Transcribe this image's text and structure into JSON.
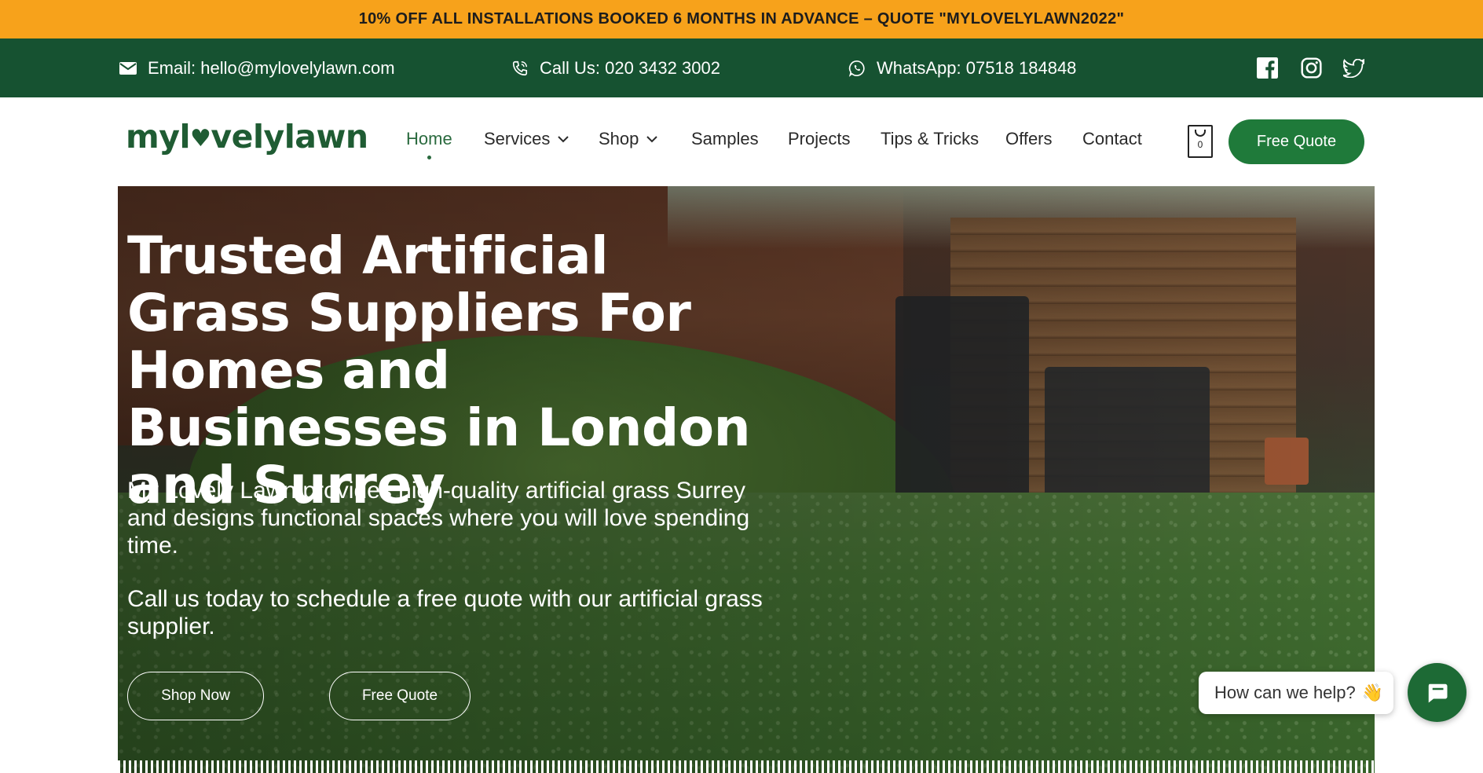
{
  "promo": {
    "text": "10% OFF ALL INSTALLATIONS BOOKED 6 MONTHS IN ADVANCE – QUOTE \"MYLOVELYLAWN2022\""
  },
  "contact": {
    "email": "Email: hello@mylovelylawn.com",
    "phone": "Call Us: 020 3432 3002",
    "whatsapp": "WhatsApp: 07518 184848"
  },
  "social": {
    "icons": [
      "facebook-icon",
      "instagram-icon",
      "twitter-icon"
    ]
  },
  "logo": {
    "part1": "myl",
    "part2": "velylawn"
  },
  "nav": {
    "home": "Home",
    "services": "Services",
    "shop": "Shop",
    "samples": "Samples",
    "projects": "Projects",
    "tips": "Tips & Tricks",
    "offers": "Offers",
    "contact": "Contact"
  },
  "cart": {
    "count": "0"
  },
  "header_button": "Free Quote",
  "hero": {
    "title": "Trusted Artificial Grass Suppliers For Homes and Businesses in London and Surrey",
    "p1": "My Lovely Lawn provides high-quality artificial grass Surrey and designs functional spaces where you will love spending time.",
    "p2": "Call us today to schedule a free quote with our artificial grass supplier.",
    "shop_button": "Shop Now",
    "quote_button": "Free Quote"
  },
  "chat": {
    "prompt": "How can we help?",
    "emoji": "👋"
  },
  "colors": {
    "promo": "#f7a21b",
    "contact_bar": "#165231",
    "accent": "#1f7a3a"
  }
}
